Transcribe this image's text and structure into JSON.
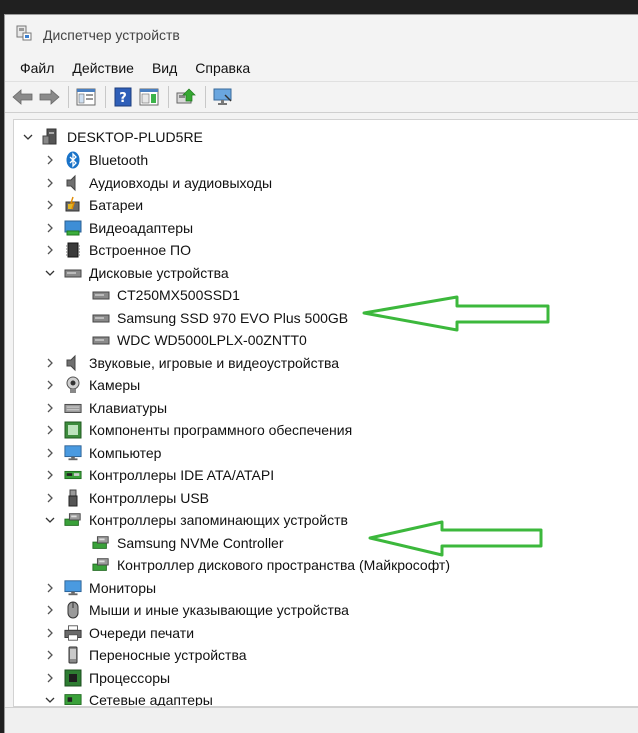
{
  "window": {
    "title": "Диспетчер устройств"
  },
  "menu": {
    "file": "Файл",
    "action": "Действие",
    "view": "Вид",
    "help": "Справка"
  },
  "tree": {
    "root": "DESKTOP-PLUD5RE",
    "bluetooth": "Bluetooth",
    "audio_io": "Аудиовходы и аудиовыходы",
    "batteries": "Батареи",
    "video_adapters": "Видеоадаптеры",
    "firmware": "Встроенное ПО",
    "disk_drives": "Дисковые устройства",
    "disk1": "CT250MX500SSD1",
    "disk2": "Samsung SSD 970 EVO Plus 500GB",
    "disk3": "WDC WD5000LPLX-00ZNTT0",
    "sound": "Звуковые, игровые и видеоустройства",
    "cameras": "Камеры",
    "keyboards": "Клавиатуры",
    "software_components": "Компоненты программного обеспечения",
    "computer": "Компьютер",
    "ide": "Контроллеры IDE ATA/ATAPI",
    "usb": "Контроллеры USB",
    "storage_controllers": "Контроллеры запоминающих устройств",
    "nvme": "Samsung NVMe Controller",
    "storage_spaces": "Контроллер дискового пространства (Майкрософт)",
    "monitors": "Мониторы",
    "mice": "Мыши и иные указывающие устройства",
    "print_queues": "Очереди печати",
    "portable": "Переносные устройства",
    "processors": "Процессоры",
    "network": "Сетевые адаптеры"
  },
  "colors": {
    "arrow": "#3cb83c",
    "accent": "#1a73c8"
  }
}
